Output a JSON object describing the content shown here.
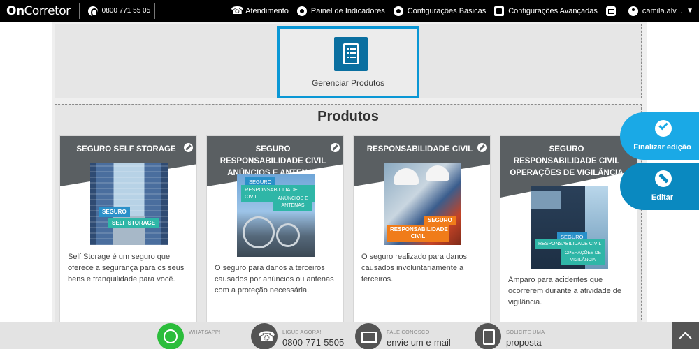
{
  "header": {
    "logo_bold": "On",
    "logo_light": "Corretor",
    "phone": "0800 771 55 05",
    "nav": [
      {
        "label": "Atendimento",
        "icon": "phone-icon"
      },
      {
        "label": "Painel de Indicadores",
        "icon": "gear-icon"
      },
      {
        "label": "Configurações Básicas",
        "icon": "gear-icon"
      },
      {
        "label": "Configurações Avançadas",
        "icon": "document-icon"
      },
      {
        "label": "",
        "icon": "mail-icon"
      }
    ],
    "user": "camila.alv..."
  },
  "manage": {
    "label": "Gerenciar Produtos",
    "icon": "list-document-icon"
  },
  "products": {
    "title": "Produtos",
    "cards": [
      {
        "title": "SEGURO SELF STORAGE",
        "tags": [
          "SEGURO",
          "SELF STORAGE"
        ],
        "description": "Self Storage é um seguro que oferece a segurança para os seus bens e tranquilidade para você."
      },
      {
        "title": "SEGURO RESPONSABILIDADE CIVIL ANÚNCIOS E ANTENAS",
        "tags": [
          "SEGURO",
          "RESPONSABILIDADE CIVIL",
          "ANÚNCIOS E ANTENAS"
        ],
        "description": "O seguro para danos a terceiros causados por anúncios ou antenas com a proteção necessária."
      },
      {
        "title": "RESPONSABILIDADE CIVIL",
        "tags": [
          "SEGURO",
          "RESPONSABILIDADE CIVIL"
        ],
        "description": "O seguro realizado para danos causados involuntariamente a terceiros."
      },
      {
        "title": "SEGURO RESPONSABILIDADE CIVIL OPERAÇÕES DE VIGILÂNCIA",
        "tags": [
          "SEGURO",
          "RESPONSABILIDADE CIVIL",
          "OPERAÇÕES DE VIGILÂNCIA"
        ],
        "description": "Amparo para acidentes que ocorrerem durante a atividade de vigilância."
      }
    ]
  },
  "side_buttons": {
    "finish": "Finalizar edição",
    "edit": "Editar"
  },
  "footer": {
    "whatsapp": {
      "small": "WHATSAPP!",
      "big": ""
    },
    "call": {
      "small": "LIGUE AGORA!",
      "big": "0800-771-5505"
    },
    "contact": {
      "small": "FALE CONOSCO",
      "big": "envie um e-mail"
    },
    "quote": {
      "small": "SOLICITE UMA",
      "big": "proposta"
    }
  },
  "colors": {
    "accent": "#0a97d5",
    "card_header": "#5a5f62",
    "whatsapp": "#2bbd3b",
    "tag_orange": "#f07c1a",
    "tag_teal": "#2fb6a7"
  }
}
